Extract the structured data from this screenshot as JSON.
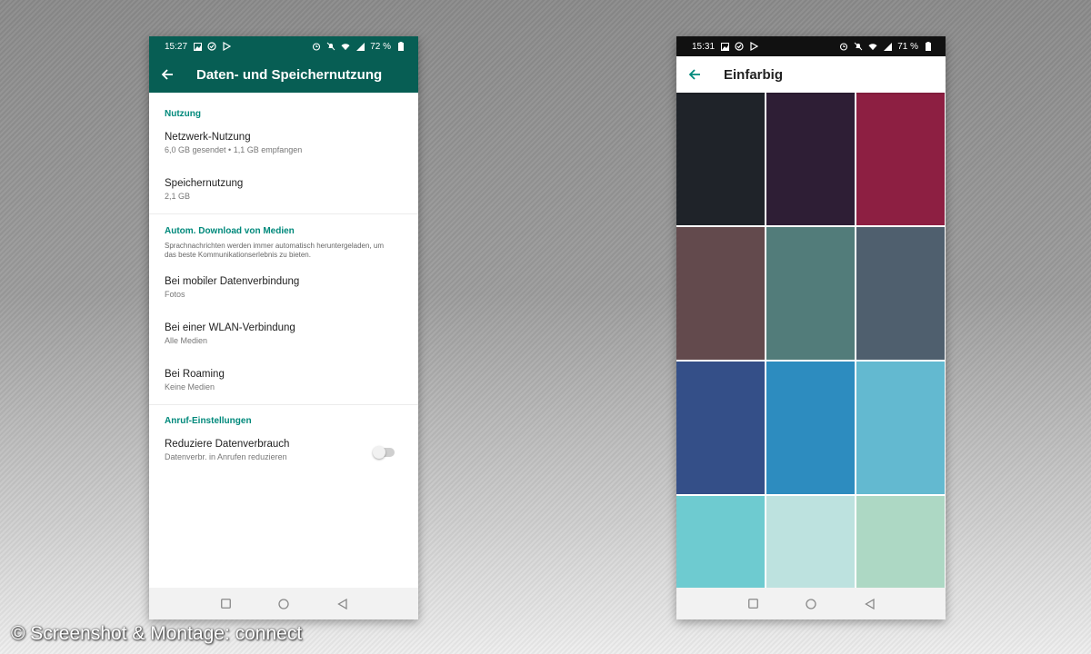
{
  "left_phone": {
    "status": {
      "time": "15:27",
      "battery": "72 %"
    },
    "title": "Daten- und Speichernutzung",
    "sections": [
      {
        "header": "Nutzung",
        "items": [
          {
            "title": "Netzwerk-Nutzung",
            "subtitle": "6,0 GB gesendet • 1,1 GB empfangen"
          },
          {
            "title": "Speichernutzung",
            "subtitle": "2,1 GB"
          }
        ]
      },
      {
        "header": "Autom. Download von Medien",
        "description": "Sprachnachrichten werden immer automatisch heruntergeladen, um das beste Kommunikationserlebnis zu bieten.",
        "items": [
          {
            "title": "Bei mobiler Datenverbindung",
            "subtitle": "Fotos"
          },
          {
            "title": "Bei einer WLAN-Verbindung",
            "subtitle": "Alle Medien"
          },
          {
            "title": "Bei Roaming",
            "subtitle": "Keine Medien"
          }
        ]
      },
      {
        "header": "Anruf-Einstellungen",
        "items": [
          {
            "title": "Reduziere Datenverbrauch",
            "subtitle": "Datenverbr. in Anrufen reduzieren",
            "toggle": false
          }
        ]
      }
    ]
  },
  "right_phone": {
    "status": {
      "time": "15:31",
      "battery": "71 %"
    },
    "title": "Einfarbig",
    "swatches": [
      "#1f2329",
      "#2e1e35",
      "#8d1f42",
      "#634a4d",
      "#527c7a",
      "#4f5f6e",
      "#344f88",
      "#2d8cbf",
      "#63b9d0",
      "#6ecbd0",
      "#bde2df",
      "#add8c4"
    ]
  },
  "colors": {
    "whatsapp_green": "#075e54",
    "accent_teal": "#00897b"
  },
  "credit": "© Screenshot & Montage: connect"
}
